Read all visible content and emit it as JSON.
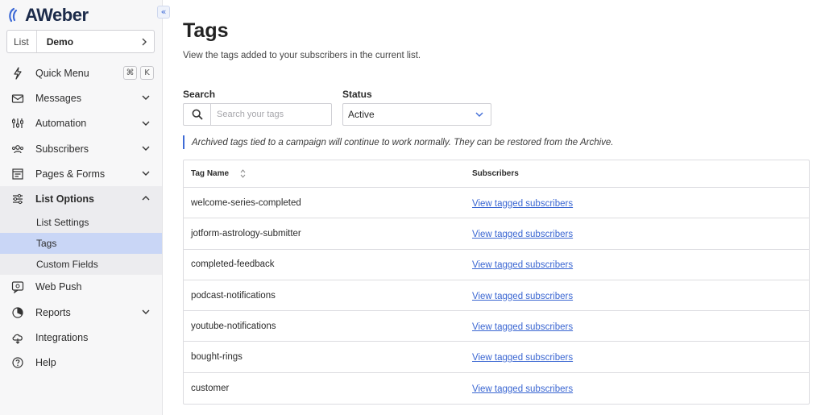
{
  "brand": {
    "name": "AWeber",
    "accent": "#3f6bd6"
  },
  "sidebar": {
    "collapse_label": "«",
    "list_selector": {
      "label": "List",
      "value": "Demo"
    },
    "quick_menu": {
      "label": "Quick Menu",
      "shortcut": [
        "⌘",
        "K"
      ]
    },
    "items": [
      {
        "label": "Messages"
      },
      {
        "label": "Automation"
      },
      {
        "label": "Subscribers"
      },
      {
        "label": "Pages & Forms"
      },
      {
        "label": "List Options"
      },
      {
        "label": "Web Push"
      },
      {
        "label": "Reports"
      },
      {
        "label": "Integrations"
      },
      {
        "label": "Help"
      }
    ],
    "submenu": [
      {
        "label": "List Settings"
      },
      {
        "label": "Tags"
      },
      {
        "label": "Custom Fields"
      }
    ]
  },
  "main": {
    "title": "Tags",
    "description": "View the tags added to your subscribers in the current list.",
    "search": {
      "label": "Search",
      "placeholder": "Search your tags"
    },
    "status": {
      "label": "Status",
      "value": "Active"
    },
    "notice": "Archived tags tied to a campaign will continue to work normally. They can be restored from the Archive.",
    "table": {
      "columns": [
        "Tag Name",
        "Subscribers"
      ],
      "rows": [
        {
          "tag": "welcome-series-completed",
          "link": "View tagged subscribers"
        },
        {
          "tag": "jotform-astrology-submitter",
          "link": "View tagged subscribers"
        },
        {
          "tag": "completed-feedback",
          "link": "View tagged subscribers"
        },
        {
          "tag": "podcast-notifications",
          "link": "View tagged subscribers"
        },
        {
          "tag": "youtube-notifications",
          "link": "View tagged subscribers"
        },
        {
          "tag": "bought-rings",
          "link": "View tagged subscribers"
        },
        {
          "tag": "customer",
          "link": "View tagged subscribers"
        }
      ]
    }
  }
}
